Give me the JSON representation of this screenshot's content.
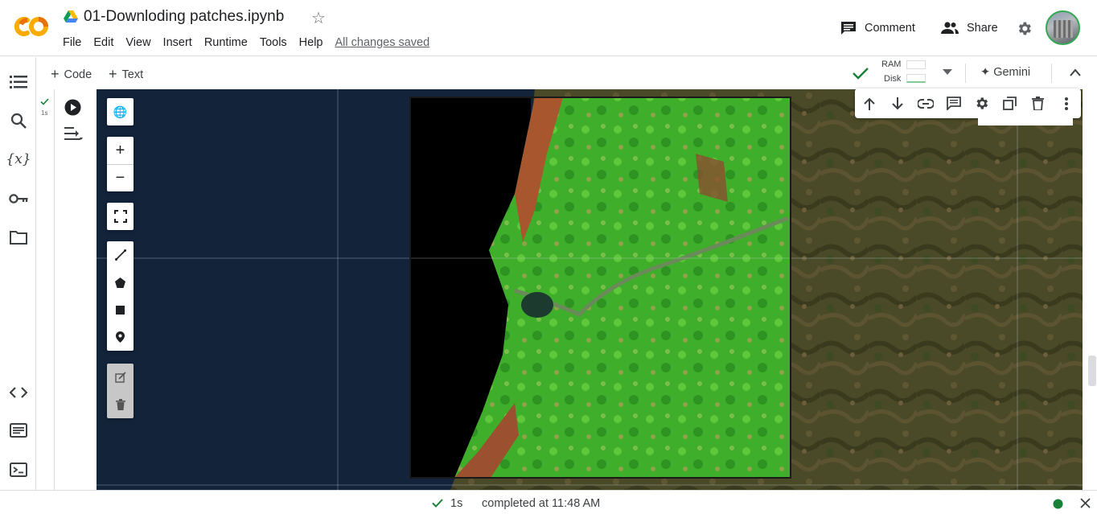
{
  "header": {
    "app_logo": "CO",
    "notebook_title": "01-Downloding patches.ipynb",
    "menu": [
      "File",
      "Edit",
      "View",
      "Insert",
      "Runtime",
      "Tools",
      "Help"
    ],
    "save_status": "All changes saved",
    "comment_label": "Comment",
    "share_label": "Share"
  },
  "toolbar": {
    "add_code_label": "Code",
    "add_text_label": "Text",
    "ram_label": "RAM",
    "disk_label": "Disk",
    "gemini_label": "Gemini"
  },
  "cell": {
    "exec_time": "1s"
  },
  "status_bar": {
    "duration": "1s",
    "completed_text": "completed at 11:48 AM"
  },
  "colors": {
    "accent_green": "#188038",
    "colab_orange": "#f9ab00",
    "map_ocean": "#12233a",
    "link_gray": "#5f6368"
  }
}
